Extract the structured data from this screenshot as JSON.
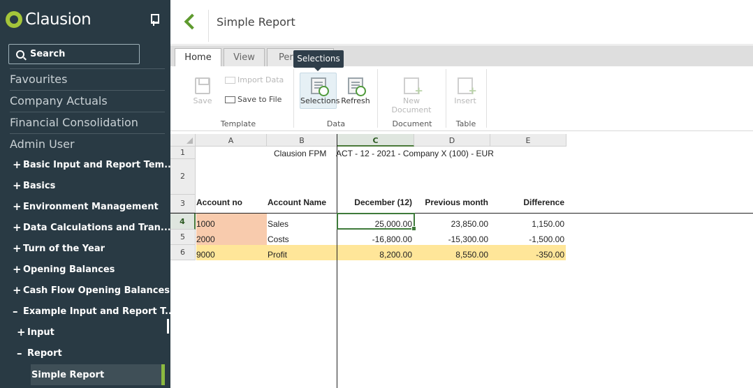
{
  "sidebar": {
    "brand": "Clausion",
    "search_label": "Search",
    "sections": [
      "Favourites",
      "Company Actuals",
      "Financial Consolidation",
      "Admin User"
    ],
    "tree": [
      {
        "sign": "+",
        "label": "Basic Input and Report Tem..."
      },
      {
        "sign": "+",
        "label": "Basics"
      },
      {
        "sign": "+",
        "label": "Environment Management"
      },
      {
        "sign": "+",
        "label": "Data Calculations and Tran..."
      },
      {
        "sign": "+",
        "label": "Turn of the Year"
      },
      {
        "sign": "+",
        "label": "Opening Balances"
      },
      {
        "sign": "+",
        "label": "Cash Flow Opening Balances"
      },
      {
        "sign": "–",
        "label": "Example Input and Report T..."
      },
      {
        "sign": "+",
        "label": "Input"
      },
      {
        "sign": "–",
        "label": "Report"
      }
    ],
    "selected_item": "Simple Report"
  },
  "header": {
    "title": "Simple Report"
  },
  "ribbon": {
    "tabs": [
      "Home",
      "View",
      "Peri"
    ],
    "tooltip": "Selections",
    "template": {
      "save": "Save",
      "import_data": "Import Data",
      "save_to_file": "Save to File",
      "label": "Template"
    },
    "data": {
      "selections": "Selections",
      "refresh": "Refresh",
      "label": "Data"
    },
    "document": {
      "new_document": "New Document",
      "label": "Document"
    },
    "table": {
      "insert": "Insert",
      "label": "Table"
    }
  },
  "sheet": {
    "columns": [
      "A",
      "B",
      "C",
      "D",
      "E"
    ],
    "row_numbers": [
      "1",
      "2",
      "3",
      "4",
      "5",
      "6"
    ],
    "row1": {
      "b": "Clausion FPM",
      "c": "ACT - 12 - 2021 - Company X (100) - EUR"
    },
    "headers": {
      "a": "Account no",
      "b": "Account Name",
      "c": "December (12)",
      "d": "Previous month",
      "e": "Difference"
    },
    "rows": [
      {
        "account_no": "1000",
        "account_name": "Sales",
        "december": "25,000.00",
        "previous": "23,850.00",
        "difference": "1,150.00"
      },
      {
        "account_no": "2000",
        "account_name": "Costs",
        "december": "-16,800.00",
        "previous": "-15,300.00",
        "difference": "-1,500.00"
      },
      {
        "account_no": "9000",
        "account_name": "Profit",
        "december": "8,200.00",
        "previous": "8,550.00",
        "difference": "-350.00"
      }
    ]
  },
  "colors": {
    "sidebar_bg": "#293a44",
    "accent_green": "#8cb940",
    "account_fill": "#f8cbad",
    "profit_fill": "#ffe699"
  }
}
